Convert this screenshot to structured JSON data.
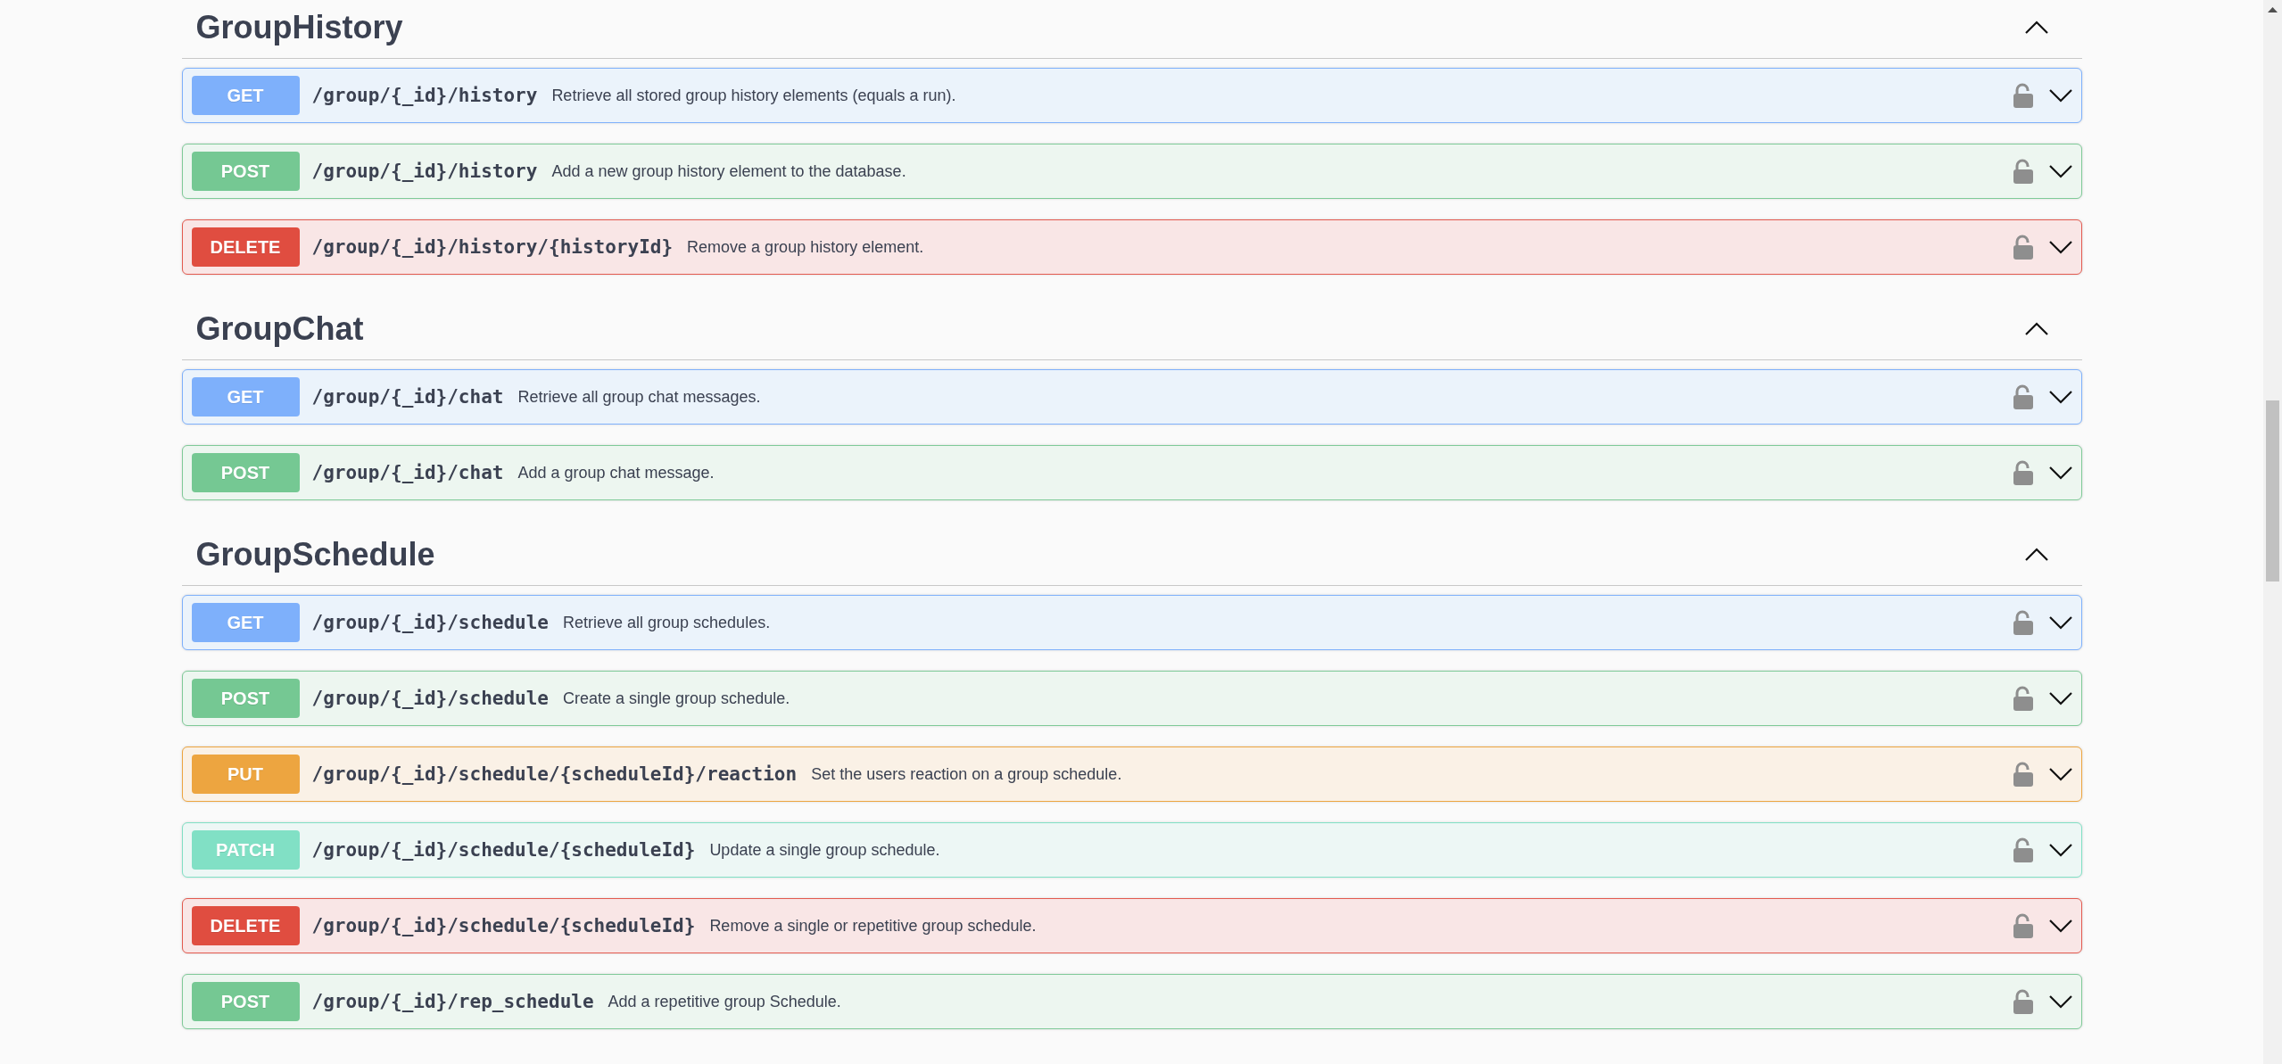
{
  "sections": [
    {
      "name": "GroupHistory",
      "expanded": true,
      "operations": [
        {
          "kind": "get",
          "method": "GET",
          "path": "/group/{_id}/history",
          "summary": "Retrieve all stored group history elements (equals a run)."
        },
        {
          "kind": "post",
          "method": "POST",
          "path": "/group/{_id}/history",
          "summary": "Add a new group history element to the database."
        },
        {
          "kind": "delete",
          "method": "DELETE",
          "path": "/group/{_id}/history/{historyId}",
          "summary": "Remove a group history element."
        }
      ]
    },
    {
      "name": "GroupChat",
      "expanded": true,
      "operations": [
        {
          "kind": "get",
          "method": "GET",
          "path": "/group/{_id}/chat",
          "summary": "Retrieve all group chat messages."
        },
        {
          "kind": "post",
          "method": "POST",
          "path": "/group/{_id}/chat",
          "summary": "Add a group chat message."
        }
      ]
    },
    {
      "name": "GroupSchedule",
      "expanded": true,
      "operations": [
        {
          "kind": "get",
          "method": "GET",
          "path": "/group/{_id}/schedule",
          "summary": "Retrieve all group schedules."
        },
        {
          "kind": "post",
          "method": "POST",
          "path": "/group/{_id}/schedule",
          "summary": "Create a single group schedule."
        },
        {
          "kind": "put",
          "method": "PUT",
          "path": "/group/{_id}/schedule/{scheduleId}/reaction",
          "summary": "Set the users reaction on a group schedule."
        },
        {
          "kind": "patch",
          "method": "PATCH",
          "path": "/group/{_id}/schedule/{scheduleId}",
          "summary": "Update a single group schedule."
        },
        {
          "kind": "delete",
          "method": "DELETE",
          "path": "/group/{_id}/schedule/{scheduleId}",
          "summary": "Remove a single or repetitive group schedule."
        },
        {
          "kind": "post",
          "method": "POST",
          "path": "/group/{_id}/rep_schedule",
          "summary": "Add a repetitive group Schedule."
        }
      ]
    }
  ]
}
